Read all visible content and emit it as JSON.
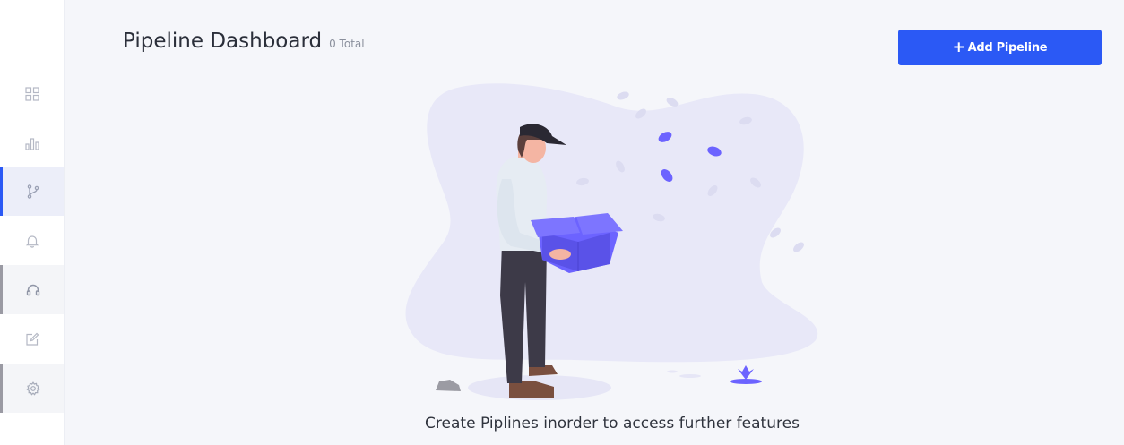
{
  "sidebar": {
    "items": [
      {
        "name": "dashboard",
        "icon": "grid-icon",
        "state": "normal"
      },
      {
        "name": "analytics",
        "icon": "bar-chart-icon",
        "state": "normal"
      },
      {
        "name": "pipelines",
        "icon": "git-branch-icon",
        "state": "active"
      },
      {
        "name": "notifications",
        "icon": "bell-icon",
        "state": "normal"
      },
      {
        "name": "support",
        "icon": "headset-icon",
        "state": "marked"
      },
      {
        "name": "edit",
        "icon": "edit-icon",
        "state": "normal"
      },
      {
        "name": "settings",
        "icon": "gear-icon",
        "state": "marked"
      }
    ]
  },
  "header": {
    "title": "Pipeline Dashboard",
    "count": "0 Total"
  },
  "actions": {
    "add_pipeline_icon": "+",
    "add_pipeline_label": "Add Pipeline"
  },
  "empty_state": {
    "illustration": "person-holding-box-illustration",
    "message": "Create Piplines inorder to access further features"
  },
  "colors": {
    "accent": "#2b59f5",
    "illustration_purple": "#6c63ff",
    "background": "#f5f6fa"
  }
}
